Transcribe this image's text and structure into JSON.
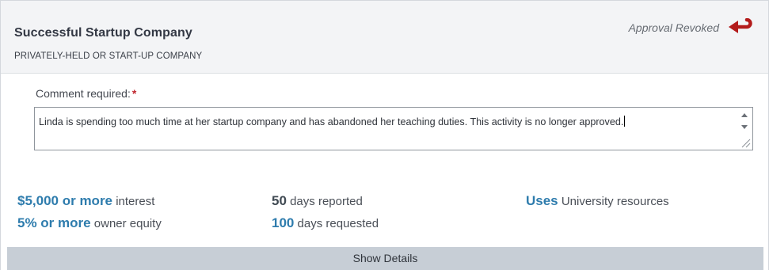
{
  "header": {
    "company_name": "Successful Startup Company",
    "company_type": "PRIVATELY-HELD OR START-UP COMPANY",
    "status_label": "Approval Revoked",
    "status_icon": "revoke-arrow-icon",
    "status_icon_color": "#b31b1b"
  },
  "comment": {
    "label": "Comment required:",
    "required_marker": "*",
    "value": "Linda is spending too much time at her startup company and has abandoned her teaching duties. This activity is no longer approved."
  },
  "stats": {
    "interest": {
      "value": "$5,000 or more",
      "label": "interest"
    },
    "equity": {
      "value": "5% or more",
      "label": "owner equity"
    },
    "reported": {
      "value": "50",
      "label": "days reported"
    },
    "requested": {
      "value": "100",
      "label": "days requested"
    },
    "resources": {
      "value": "Uses",
      "label": "University resources"
    }
  },
  "show_details_label": "Show Details",
  "colors": {
    "accent": "#2e7cad",
    "header_bg": "#f3f4f6",
    "footer_bg": "#c7ced6",
    "required": "#c0262e"
  }
}
